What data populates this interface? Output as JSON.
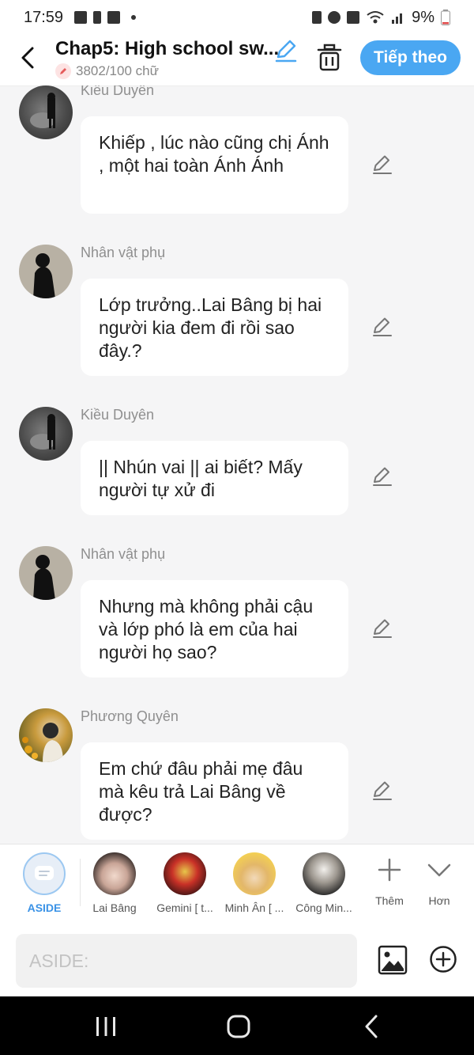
{
  "status_bar": {
    "time": "17:59",
    "battery": "9%"
  },
  "header": {
    "title": "Chap5: High school sw...",
    "word_count": "3802/100 chữ",
    "next_label": "Tiếp theo"
  },
  "messages": [
    {
      "sender": "Kiều Duyên",
      "text": "Khiếp , lúc nào cũng chị Ánh , một hai toàn Ánh Ánh",
      "avatar": "dark-photo"
    },
    {
      "sender": "Nhân vật phụ",
      "text": "Lớp trưởng..Lai Bâng bị hai người kia đem đi rồi sao đây.?",
      "avatar": "silhouette"
    },
    {
      "sender": "Kiều Duyên",
      "text": "|| Nhún vai || ai biết? Mấy người tự xử đi",
      "avatar": "dark-photo"
    },
    {
      "sender": "Nhân vật phụ",
      "text": "Nhưng mà không phải cậu và lớp phó là em của hai người họ sao?",
      "avatar": "silhouette"
    },
    {
      "sender": "Phương Quyên",
      "text": "Em chứ đâu phải mẹ đâu mà kêu trả Lai Bâng về được?",
      "avatar": "flower-photo"
    }
  ],
  "characters": [
    {
      "name": "ASIDE"
    },
    {
      "name": "Lai Bâng"
    },
    {
      "name": "Gemini [ t..."
    },
    {
      "name": "Minh Ân [ ..."
    },
    {
      "name": "Công Min..."
    }
  ],
  "tools": {
    "more_label": "Thêm",
    "less_label": "Hơn"
  },
  "input": {
    "placeholder": "ASIDE:"
  },
  "colors": {
    "accent": "#4aa7f2",
    "aside": "#3a92e6"
  }
}
